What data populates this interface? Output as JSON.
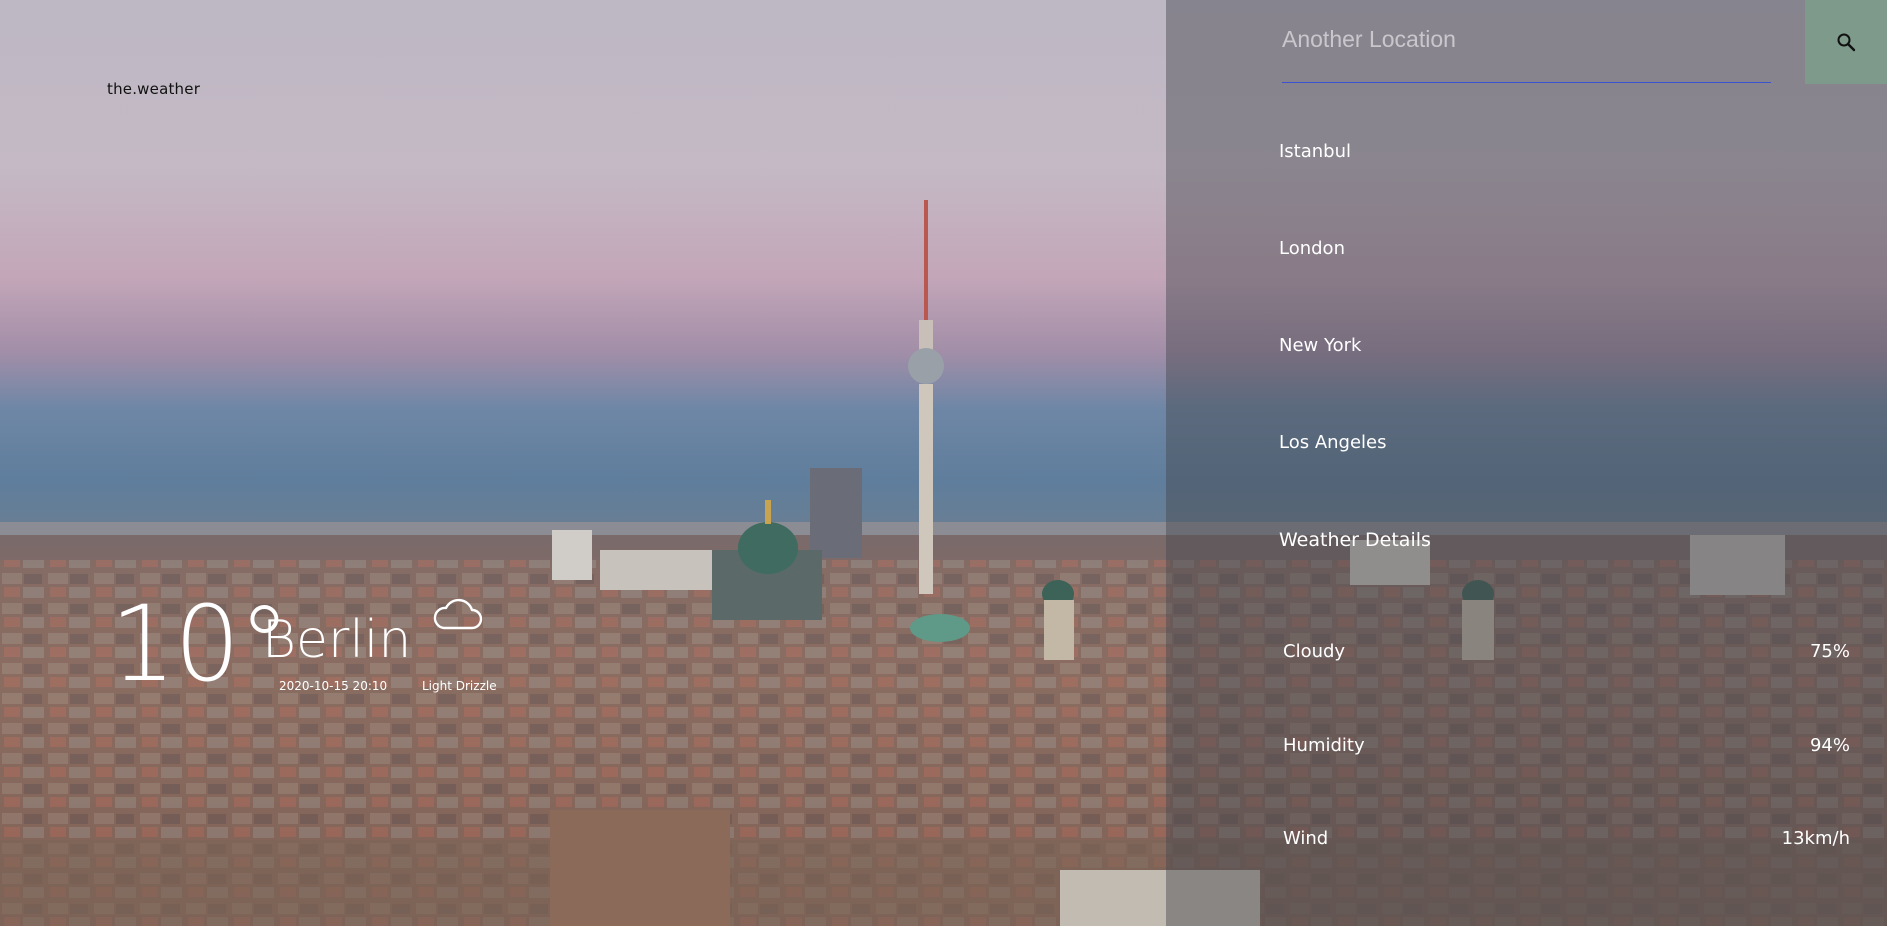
{
  "brand": "the.weather",
  "current": {
    "temperature": "10°",
    "city": "Berlin",
    "datetime": "2020-10-15 20:10",
    "condition": "Light Drizzle",
    "icon": "cloud-icon"
  },
  "search": {
    "placeholder": "Another Location",
    "icon": "search-icon"
  },
  "locations": [
    "Istanbul",
    "London",
    "New York",
    "Los Angeles"
  ],
  "details": {
    "title": "Weather Details",
    "rows": [
      {
        "label": "Cloudy",
        "value": "75%"
      },
      {
        "label": "Humidity",
        "value": "94%"
      },
      {
        "label": "Wind",
        "value": "13km/h"
      }
    ]
  },
  "colors": {
    "search_button": "#7d9a8b",
    "search_underline": "#3a52d0"
  }
}
